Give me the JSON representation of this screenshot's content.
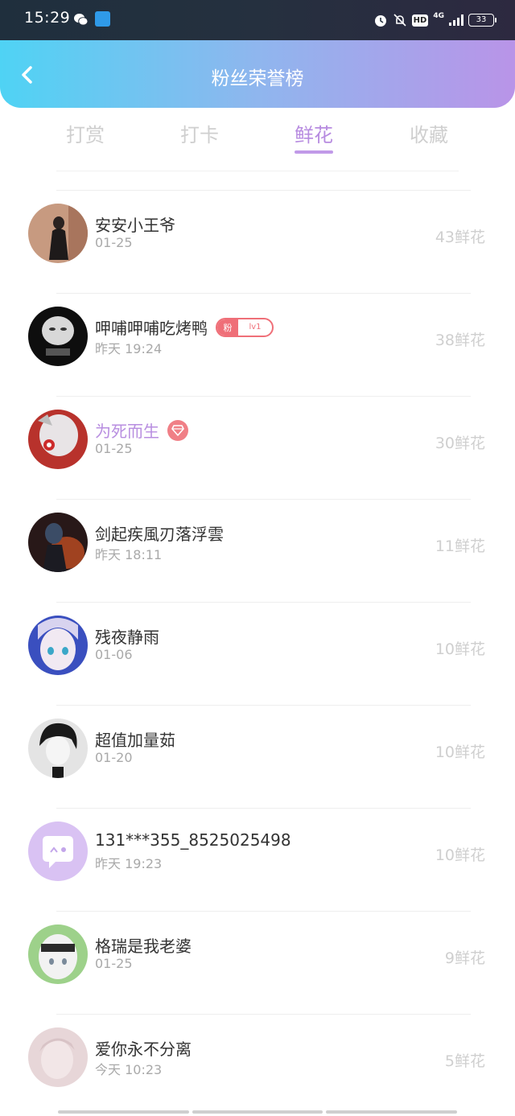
{
  "status_bar": {
    "time": "15:29",
    "hd": "HD",
    "network": "4G",
    "battery": "33"
  },
  "header": {
    "title": "粉丝荣誉榜",
    "back_icon": "chevron-left-icon"
  },
  "tabs": [
    {
      "label": "打赏",
      "active": false
    },
    {
      "label": "打卡",
      "active": false
    },
    {
      "label": "鲜花",
      "active": true
    },
    {
      "label": "收藏",
      "active": false
    }
  ],
  "colors": {
    "accent": "#b78be0",
    "fan_badge": "#ef6f78",
    "header_gradient_start": "#4fd3f4",
    "header_gradient_end": "#b994e8"
  },
  "list": [
    {
      "name": "安安小王爷",
      "date": "01-25",
      "count": "43鲜花"
    },
    {
      "name": "呷哺呷哺吃烤鸭",
      "date": "昨天 19:24",
      "count": "38鲜花",
      "fan_badge": {
        "left": "粉",
        "right": "lv1"
      }
    },
    {
      "name": "为死而生",
      "date": "01-25",
      "count": "30鲜花",
      "vip": true,
      "badge_icon": "diamond-icon"
    },
    {
      "name": "剑起疾風刃落浮雲",
      "date": "昨天 18:11",
      "count": "11鲜花"
    },
    {
      "name": "残夜静雨",
      "date": "01-06",
      "count": "10鲜花"
    },
    {
      "name": "超值加量茹",
      "date": "01-20",
      "count": "10鲜花"
    },
    {
      "name": "131***355_8525025498",
      "date": "昨天 19:23",
      "count": "10鲜花"
    },
    {
      "name": "格瑞是我老婆",
      "date": "01-25",
      "count": "9鲜花"
    },
    {
      "name": "爱你永不分离",
      "date": "今天 10:23",
      "count": "5鲜花"
    }
  ]
}
